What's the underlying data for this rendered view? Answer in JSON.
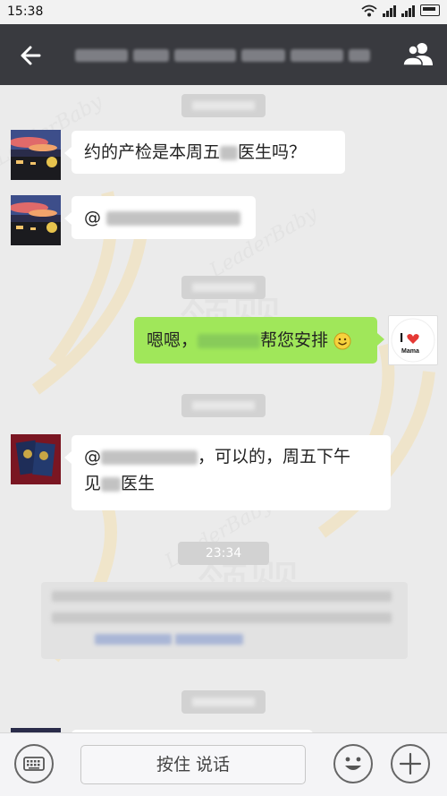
{
  "status_bar": {
    "time": "15:38",
    "icons": [
      "wifi-icon",
      "signal-icon",
      "signal-icon",
      "battery-icon"
    ]
  },
  "header": {
    "back_icon": "back-arrow-icon",
    "title": "",
    "group_icon": "group-members-icon"
  },
  "messages": [
    {
      "type": "timestamp",
      "text": ""
    },
    {
      "type": "incoming",
      "avatar": "sunset-photo-avatar",
      "text_before": "约的产检是本周五",
      "text_after": "医生吗？"
    },
    {
      "type": "incoming",
      "avatar": "sunset-photo-avatar",
      "text": "@"
    },
    {
      "type": "timestamp",
      "text": ""
    },
    {
      "type": "outgoing",
      "avatar": "i-love-mama-avatar",
      "avatar_text_top": "I",
      "avatar_text_bottom": "Mama",
      "text_before": "嗯嗯，",
      "text_after": "帮您安排",
      "emoji": "smile-emoji"
    },
    {
      "type": "timestamp",
      "text": ""
    },
    {
      "type": "incoming",
      "avatar": "passport-photo-avatar",
      "line1_before": "@",
      "line1_after": "，可以的，周五下午",
      "line2_before": "见",
      "line2_after": "医生"
    },
    {
      "type": "timestamp",
      "text": "23:34"
    },
    {
      "type": "system_card",
      "text": ""
    },
    {
      "type": "timestamp",
      "text": ""
    }
  ],
  "composer": {
    "keyboard_icon": "keyboard-icon",
    "hold_to_talk_label": "按住 说话",
    "emoji_icon": "emoji-icon",
    "add_icon": "plus-icon"
  },
  "colors": {
    "title_bar": "#393a3f",
    "chat_background": "#ebebeb",
    "outgoing_bubble": "#a0e75a",
    "incoming_bubble": "#ffffff",
    "time_pill": "#d2d2d2"
  },
  "watermark": {
    "latin": "LeaderBaby",
    "chinese_main": "领婴",
    "chinese_sub": "海外孕产"
  }
}
